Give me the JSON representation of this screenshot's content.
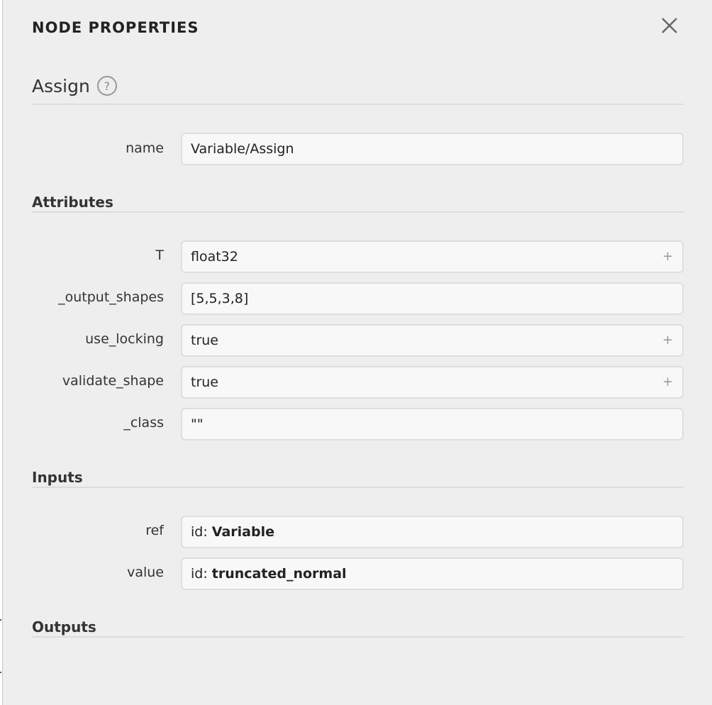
{
  "panel": {
    "title": "NODE PROPERTIES",
    "close_icon": "close-icon"
  },
  "operator": {
    "name": "Assign",
    "help_label": "?"
  },
  "node": {
    "name_label": "name",
    "name_value": "Variable/Assign"
  },
  "sections": {
    "attributes": "Attributes",
    "inputs": "Inputs",
    "outputs": "Outputs"
  },
  "attributes": [
    {
      "label": "T",
      "value": "float32",
      "expandable": true
    },
    {
      "label": "_output_shapes",
      "value": "[5,5,3,8]",
      "expandable": false
    },
    {
      "label": "use_locking",
      "value": "true",
      "expandable": true
    },
    {
      "label": "validate_shape",
      "value": "true",
      "expandable": true
    },
    {
      "label": "_class",
      "value": "\"\"",
      "expandable": false
    }
  ],
  "inputs": [
    {
      "label": "ref",
      "prefix": "id: ",
      "value": "Variable"
    },
    {
      "label": "value",
      "prefix": "id: ",
      "value": "truncated_normal"
    }
  ],
  "icons": {
    "expand": "+",
    "help": "help-icon",
    "close": "close-icon"
  },
  "colors": {
    "panel_bg": "#eeeeee",
    "field_bg": "#f8f8f8",
    "field_border": "#dedede",
    "rule": "#dcdcdc"
  }
}
